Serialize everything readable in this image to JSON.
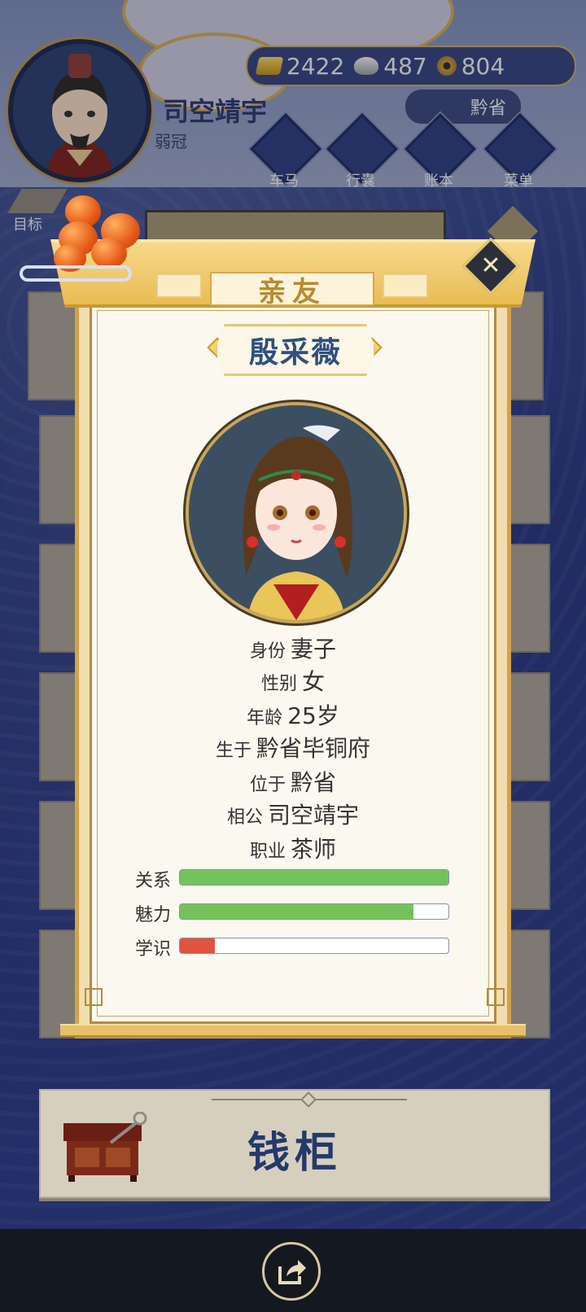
{
  "player": {
    "name": "司空靖宇",
    "title": "弱冠"
  },
  "currency": {
    "gold": "2422",
    "silver": "487",
    "copper": "804"
  },
  "location": "黔省",
  "topnav": [
    {
      "label": "车马",
      "icon": "carriage-icon"
    },
    {
      "label": "行囊",
      "icon": "bag-icon"
    },
    {
      "label": "账本",
      "icon": "ledger-icon"
    },
    {
      "label": "菜单",
      "icon": "menu-icon"
    }
  ],
  "target_label": "目标",
  "background_panel_title": "亲友",
  "money_cabinet_label": "钱柜",
  "dialog": {
    "title": "亲友",
    "person_name": "殷采薇",
    "info": [
      {
        "key": "身份",
        "value": "妻子"
      },
      {
        "key": "性别",
        "value": "女"
      },
      {
        "key": "年龄",
        "value": "25岁"
      },
      {
        "key": "生于",
        "value": "黔省毕铜府"
      },
      {
        "key": "位于",
        "value": "黔省"
      },
      {
        "key": "相公",
        "value": "司空靖宇"
      },
      {
        "key": "职业",
        "value": "茶师"
      }
    ],
    "stats": [
      {
        "label": "关系",
        "fraction": 1.0,
        "color": "#74c35a"
      },
      {
        "label": "魅力",
        "fraction": 0.87,
        "color": "#74c35a"
      },
      {
        "label": "学识",
        "fraction": 0.13,
        "color": "#e0533e"
      }
    ]
  },
  "colors": {
    "accent_gold": "#e9bc55",
    "name_blue": "#2f4f7e",
    "bar_green": "#74c35a",
    "bar_red": "#e0533e"
  }
}
